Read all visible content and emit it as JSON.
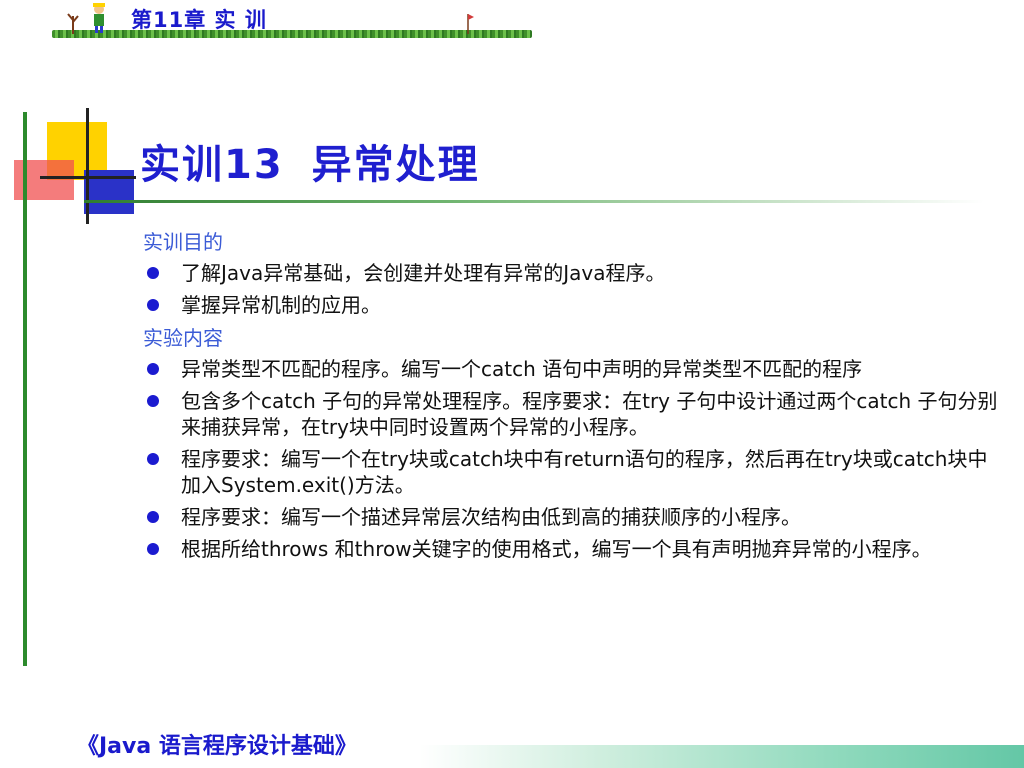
{
  "header": {
    "chapter_title": "第11章  实 训"
  },
  "slide": {
    "title_prefix": "实训13",
    "title_text": "异常处理"
  },
  "sections": [
    {
      "heading": "实训目的",
      "items": [
        "了解Java异常基础，会创建并处理有异常的Java程序。",
        "掌握异常机制的应用。"
      ]
    },
    {
      "heading": "实验内容",
      "items": [
        "异常类型不匹配的程序。编写一个catch 语句中声明的异常类型不匹配的程序",
        "包含多个catch 子句的异常处理程序。程序要求：在try 子句中设计通过两个catch 子句分别来捕获异常，在try块中同时设置两个异常的小程序。",
        "程序要求：编写一个在try块或catch块中有return语句的程序，然后再在try块或catch块中加入System.exit()方法。",
        "程序要求：编写一个描述异常层次结构由低到高的捕获顺序的小程序。",
        "根据所给throws 和throw关键字的使用格式，编写一个具有声明抛弃异常的小程序。"
      ]
    }
  ],
  "footer": {
    "book_title": "《Java 语言程序设计基础》"
  },
  "colors": {
    "title_blue": "#1f1fcf",
    "section_blue": "#3b5bd6",
    "bullet_blue": "#1b1bd0",
    "accent_yellow": "#ffd200",
    "accent_blue": "#2a32c8",
    "accent_red": "#f05050",
    "accent_green": "#2c8a2c"
  },
  "icons": {
    "bullet": "filled-circle-bullet-icon",
    "header_figure": "cartoon-figure-icon"
  }
}
